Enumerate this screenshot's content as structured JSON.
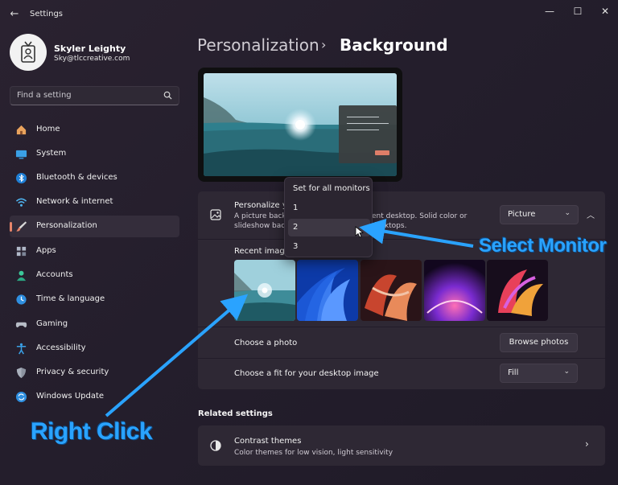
{
  "window": {
    "title": "Settings"
  },
  "profile": {
    "name": "Skyler Leighty",
    "email": "Sky@tlccreative.com"
  },
  "search": {
    "placeholder": "Find a setting"
  },
  "nav": [
    {
      "label": "Home",
      "icon": "home-icon",
      "active": false
    },
    {
      "label": "System",
      "icon": "system-icon",
      "active": false
    },
    {
      "label": "Bluetooth & devices",
      "icon": "bluetooth-icon",
      "active": false
    },
    {
      "label": "Network & internet",
      "icon": "network-icon",
      "active": false
    },
    {
      "label": "Personalization",
      "icon": "personalization-icon",
      "active": true
    },
    {
      "label": "Apps",
      "icon": "apps-icon",
      "active": false
    },
    {
      "label": "Accounts",
      "icon": "accounts-icon",
      "active": false
    },
    {
      "label": "Time & language",
      "icon": "time-language-icon",
      "active": false
    },
    {
      "label": "Gaming",
      "icon": "gaming-icon",
      "active": false
    },
    {
      "label": "Accessibility",
      "icon": "accessibility-icon",
      "active": false
    },
    {
      "label": "Privacy & security",
      "icon": "privacy-icon",
      "active": false
    },
    {
      "label": "Windows Update",
      "icon": "windows-update-icon",
      "active": false
    }
  ],
  "breadcrumb": {
    "parent": "Personalization",
    "separator": "›",
    "current": "Background"
  },
  "personalize": {
    "title": "Personalize y",
    "desc_line1": "A picture backg",
    "desc_line1_end": "ent desktop. Solid color or",
    "desc_line2": "slideshow back",
    "desc_line2_end": "desktops.",
    "dropdown_value": "Picture"
  },
  "recent_images": {
    "label": "Recent image"
  },
  "choose_photo": {
    "label": "Choose a photo",
    "button": "Browse photos"
  },
  "choose_fit": {
    "label": "Choose a fit for your desktop image",
    "value": "Fill"
  },
  "related": {
    "title": "Related settings",
    "contrast_title": "Contrast themes",
    "contrast_desc": "Color themes for low vision, light sensitivity"
  },
  "popup": {
    "items": [
      "Set for all monitors",
      "1",
      "2",
      "3"
    ],
    "selected": "2"
  },
  "annotations": {
    "select_monitor": "Select Monitor",
    "right_click": "Right Click"
  },
  "colors": {
    "accent": "#e8856a",
    "annotation": "#2aa3ff"
  }
}
